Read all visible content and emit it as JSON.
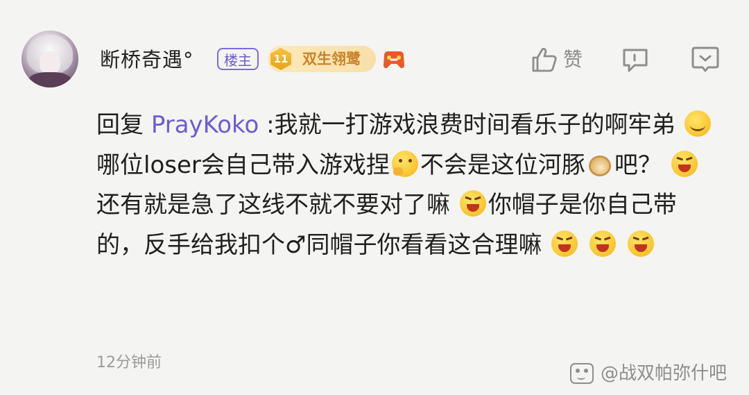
{
  "post": {
    "author": "断桥奇遇°",
    "op_badge": "楼主",
    "level_number": "11",
    "level_title": "双生翎鹭",
    "like_label": "赞",
    "timestamp": "12分钟前"
  },
  "reply": {
    "prefix": "回复 ",
    "target_user": "PrayKoko",
    "segments": [
      " :我就一打游戏浪费时间看乐子的啊牢弟 ",
      "哪位loser会自己带入游戏捏",
      "不会是这位河豚",
      "吧？ ",
      "还有就是急了这线不就不要对了嘛 ",
      "你帽子是你自己带的，反手给我扣个♂同帽子你看看这合理嘛 "
    ],
    "emojis": {
      "smile": "smiling-face-emoji",
      "think": "thinking-face-emoji",
      "puffer": "pufferfish-emoji",
      "laugh": "grinning-squint-face-emoji"
    }
  },
  "watermark": {
    "text": "@战双帕弥什吧",
    "icon": "baidu-tieba-icon"
  },
  "colors": {
    "background": "#f4f4f2",
    "accent_purple": "#6b5cd1",
    "level_gold": "#c9822a",
    "muted": "#9a9a9a"
  }
}
